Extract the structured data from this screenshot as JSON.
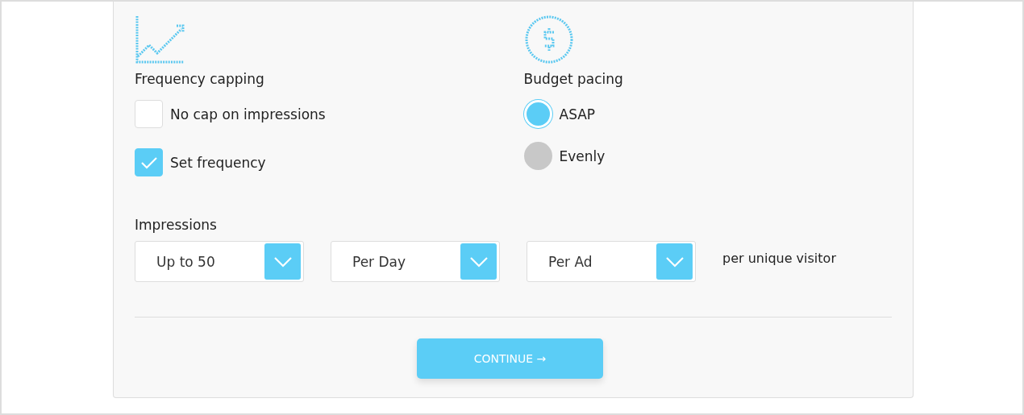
{
  "frequency_capping": {
    "title": "Frequency capping",
    "options": [
      {
        "label": "No cap on impressions",
        "checked": false
      },
      {
        "label": "Set frequency",
        "checked": true
      }
    ]
  },
  "budget_pacing": {
    "title": "Budget pacing",
    "options": [
      {
        "label": "ASAP",
        "selected": true
      },
      {
        "label": "Evenly",
        "selected": false
      }
    ]
  },
  "impressions": {
    "title": "Impressions",
    "dropdowns": [
      {
        "value": "Up to 50"
      },
      {
        "value": "Per Day"
      },
      {
        "value": "Per Ad"
      }
    ],
    "suffix": "per unique visitor"
  },
  "continue_button": {
    "label": "CONTINUE →"
  }
}
